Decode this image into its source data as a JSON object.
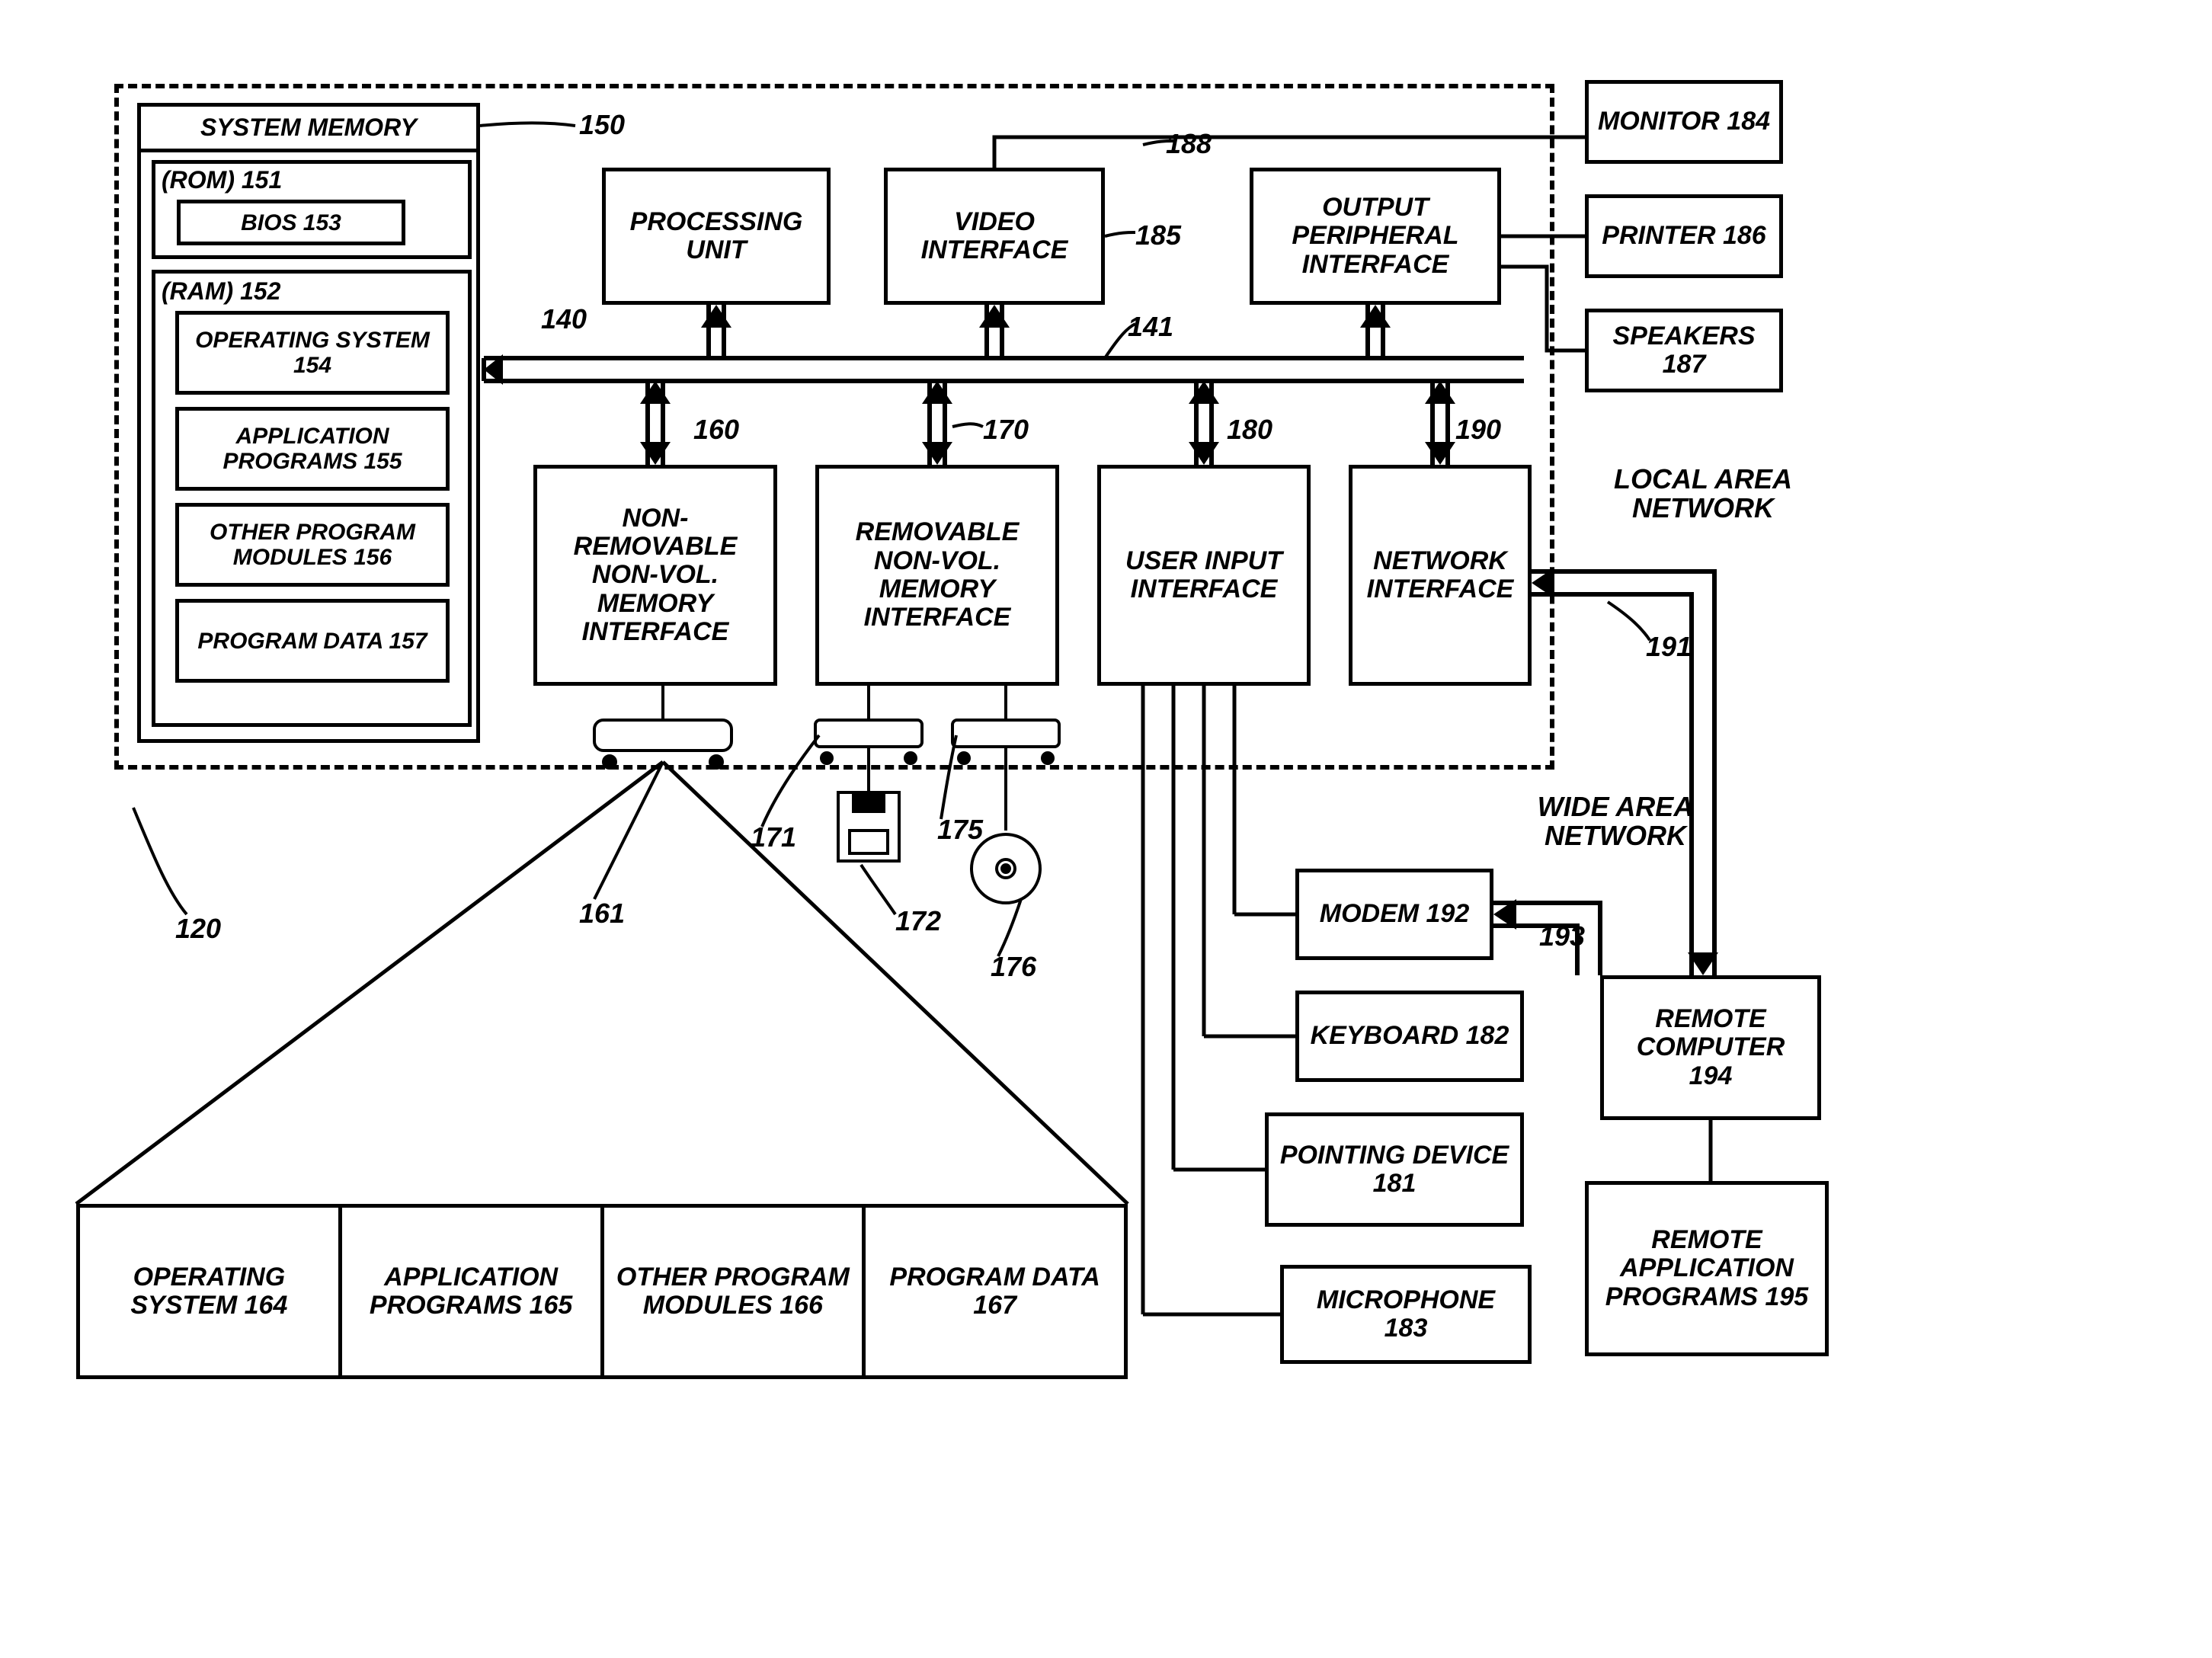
{
  "system_memory": {
    "title": "SYSTEM MEMORY",
    "rom": {
      "label": "(ROM) 151",
      "bios": "BIOS 153"
    },
    "ram": {
      "label": "(RAM) 152",
      "os": "OPERATING SYSTEM 154",
      "apps": "APPLICATION PROGRAMS 155",
      "modules": "OTHER PROGRAM MODULES 156",
      "data": "PROGRAM DATA 157"
    }
  },
  "blocks": {
    "processing_unit": "PROCESSING UNIT",
    "video_interface": "VIDEO INTERFACE",
    "output_peripheral_interface": "OUTPUT PERIPHERAL INTERFACE",
    "non_removable": "NON-REMOVABLE NON-VOL. MEMORY INTERFACE",
    "removable": "REMOVABLE NON-VOL. MEMORY INTERFACE",
    "user_input": "USER INPUT INTERFACE",
    "network_interface": "NETWORK INTERFACE",
    "monitor": "MONITOR 184",
    "printer": "PRINTER 186",
    "speakers": "SPEAKERS 187",
    "modem": "MODEM 192",
    "keyboard": "KEYBOARD 182",
    "pointing": "POINTING DEVICE 181",
    "microphone": "MICROPHONE 183",
    "remote_computer": "REMOTE COMPUTER 194",
    "remote_apps": "REMOTE APPLICATION PROGRAMS 195"
  },
  "bottom_row": {
    "os": "OPERATING SYSTEM 164",
    "apps": "APPLICATION PROGRAMS 165",
    "modules": "OTHER PROGRAM MODULES 166",
    "data": "PROGRAM DATA 167"
  },
  "refs": {
    "r150": "150",
    "r140": "140",
    "r185": "185",
    "r188": "188",
    "r141": "141",
    "r160": "160",
    "r170": "170",
    "r180": "180",
    "r190": "190",
    "r120": "120",
    "r161": "161",
    "r171": "171",
    "r172": "172",
    "r175": "175",
    "r176": "176",
    "r191": "191",
    "r193": "193",
    "lan": "LOCAL AREA NETWORK",
    "wan": "WIDE AREA NETWORK"
  }
}
